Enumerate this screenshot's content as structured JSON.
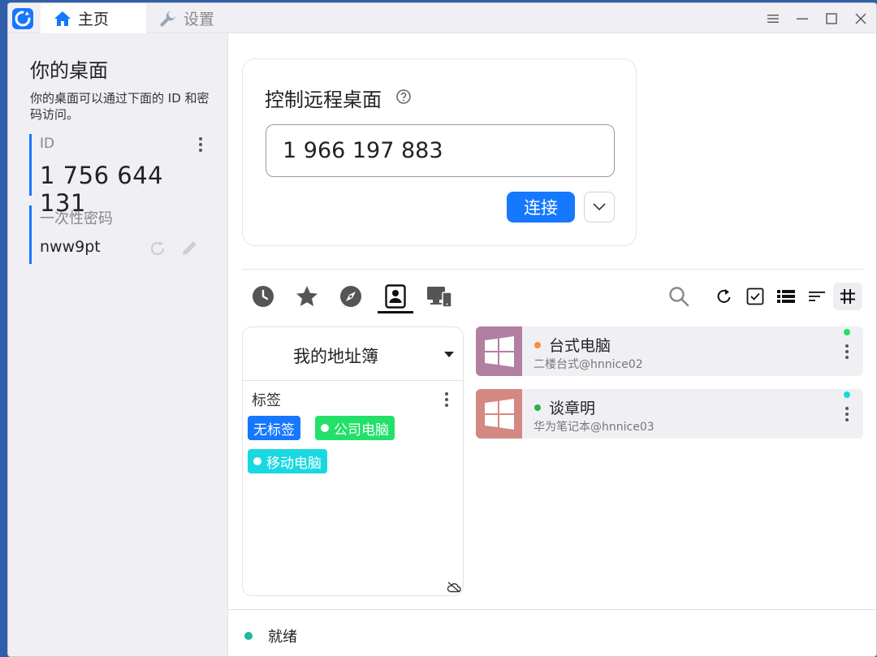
{
  "titlebar": {
    "tabs": [
      {
        "label": "主页",
        "icon": "home-icon"
      },
      {
        "label": "设置",
        "icon": "wrench-icon"
      }
    ],
    "window_controls": [
      "menu-icon",
      "minimize-icon",
      "maximize-icon",
      "close-icon"
    ]
  },
  "left_panel": {
    "title": "你的桌面",
    "description": "你的桌面可以通过下面的 ID 和密码访问。",
    "id_label": "ID",
    "id_value": "1 756 644 131",
    "password_label": "一次性密码",
    "password_value": "nww9pt"
  },
  "connect": {
    "title": "控制远程桌面",
    "remote_id": "1 966 197 883",
    "button_label": "连接"
  },
  "toolbar": {
    "tabs": [
      "clock-icon",
      "star-icon",
      "compass-icon",
      "address-book-icon",
      "devices-icon"
    ],
    "active_tab": "address-book-icon",
    "actions": [
      "search-icon",
      "refresh-icon",
      "checkbox-icon",
      "list-view-icon",
      "sort-icon",
      "grid-hash-icon"
    ]
  },
  "address_book": {
    "title": "我的地址簿",
    "tags_label": "标签",
    "tags": [
      {
        "label": "无标签",
        "color": "#1677ff",
        "dot": false
      },
      {
        "label": "公司电脑",
        "color": "#22e06a",
        "dot": true
      },
      {
        "label": "移动电脑",
        "color": "#1ad8e0",
        "dot": true
      }
    ]
  },
  "peers": [
    {
      "name": "台式电脑",
      "subtitle": "二楼台式@hnnice02",
      "status_color": "#ff8a3d",
      "tag_color": "#22e06a",
      "thumb_color": "#b27fa0"
    },
    {
      "name": "谈章明",
      "subtitle": "华为笔记本@hnnice03",
      "status_color": "#2bb04b",
      "tag_color": "#1ad8e0",
      "thumb_color": "#d48882"
    }
  ],
  "status": {
    "text": "就绪",
    "color": "#1fb89a"
  },
  "colors": {
    "accent": "#1677ff",
    "sidebar_bg": "#f0f0f4"
  }
}
